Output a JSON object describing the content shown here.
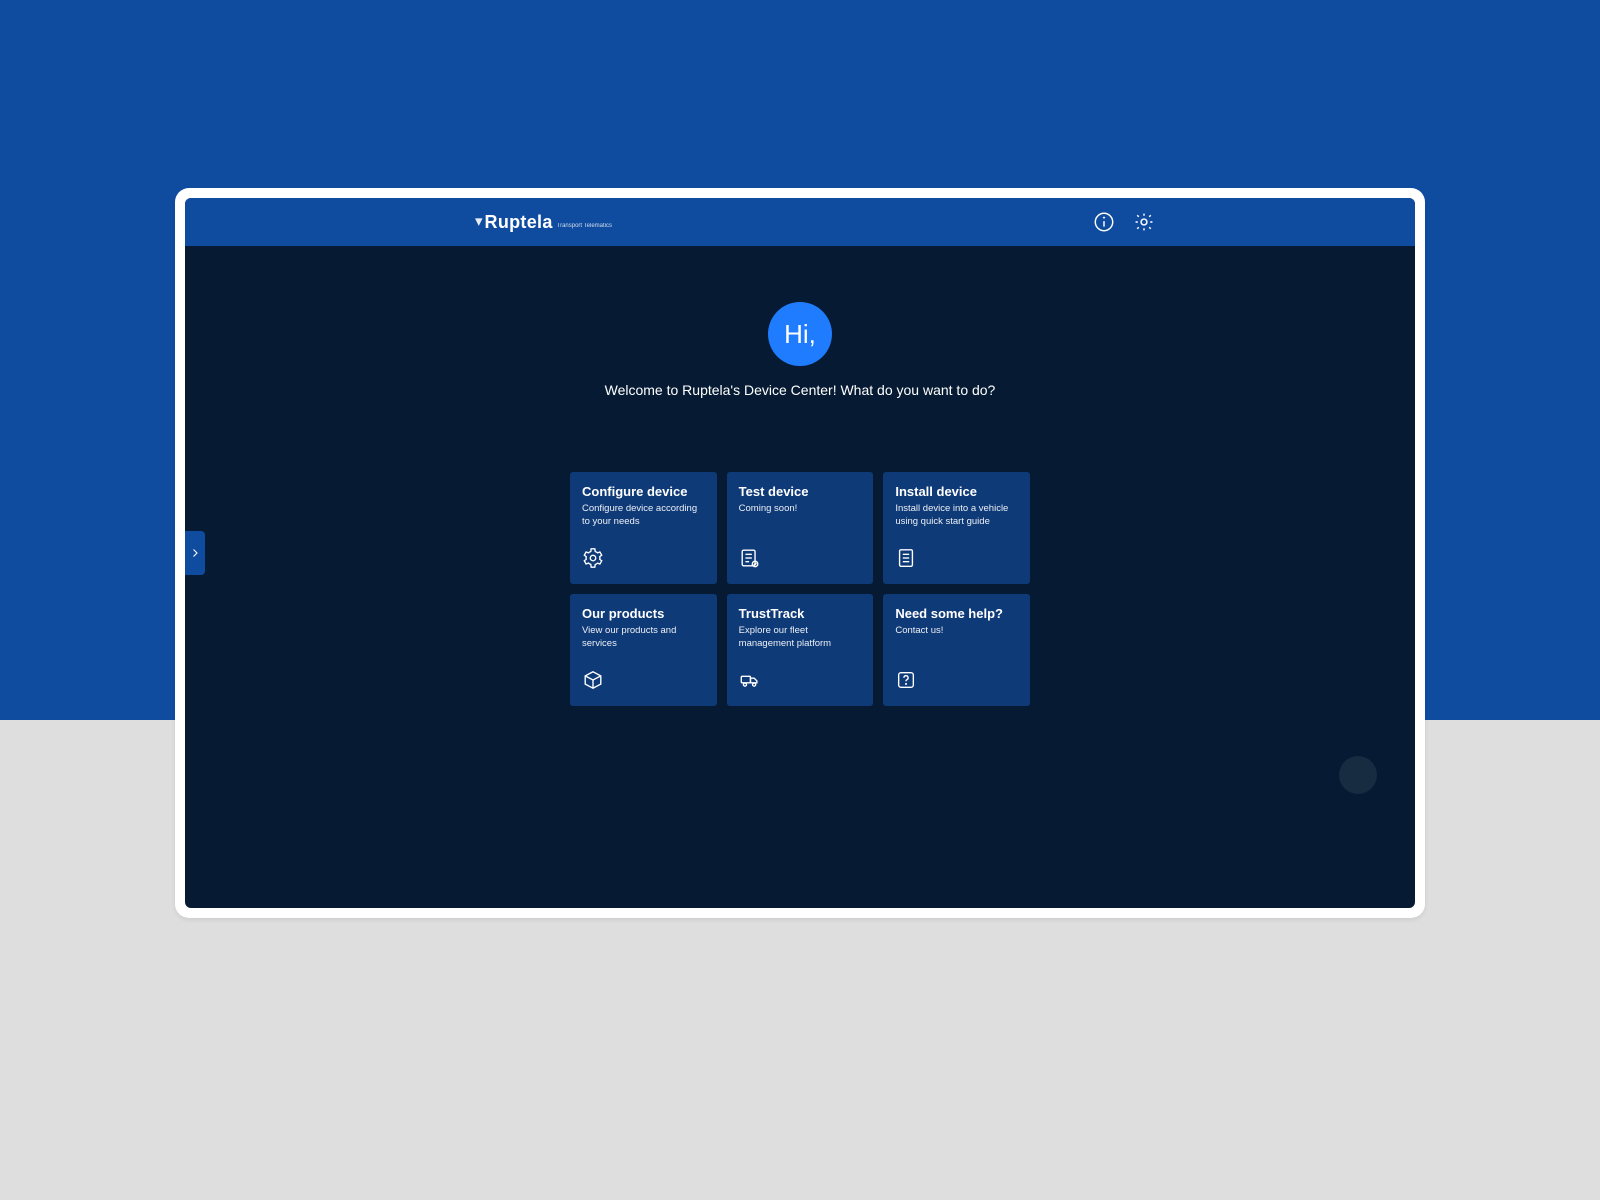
{
  "brand": {
    "name": "Ruptela",
    "tagline": "Transport Telematics"
  },
  "hero": {
    "greeting": "Hi,",
    "welcome": "Welcome to Ruptela's Device Center! What do you want to do?"
  },
  "tiles": [
    {
      "id": "configure",
      "title": "Configure device",
      "desc": "Configure device according to your needs",
      "icon": "gear-icon"
    },
    {
      "id": "test",
      "title": "Test device",
      "desc": "Coming soon!",
      "icon": "checklist-icon"
    },
    {
      "id": "install",
      "title": "Install device",
      "desc": "Install device into a vehicle using quick start guide",
      "icon": "document-icon"
    },
    {
      "id": "products",
      "title": "Our products",
      "desc": "View our products and services",
      "icon": "box-icon"
    },
    {
      "id": "trusttrack",
      "title": "TrustTrack",
      "desc": "Explore our fleet management platform",
      "icon": "truck-icon"
    },
    {
      "id": "help",
      "title": "Need some help?",
      "desc": "Contact us!",
      "icon": "help-icon"
    }
  ],
  "colors": {
    "brand_blue": "#0f4ca0",
    "tile_blue": "#0f3a78",
    "app_bg": "#061b33",
    "accent": "#1f7cff",
    "page_grey": "#dedede"
  }
}
